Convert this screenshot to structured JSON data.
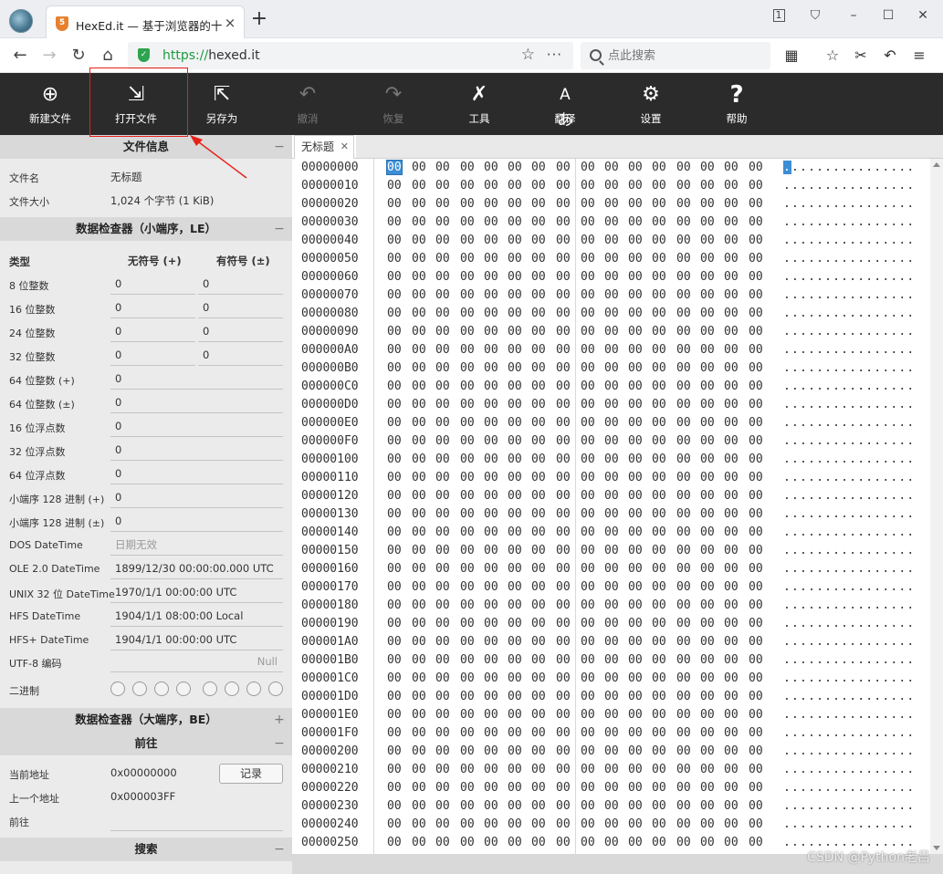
{
  "browser": {
    "tab_title": "HexEd.it — 基于浏览器的十六",
    "url_proto": "https://",
    "url_host": "hexed.it",
    "search_placeholder": "点此搜索",
    "tab_count": "1"
  },
  "toolbar": [
    {
      "label": "新建文件",
      "icon": "new-file-icon",
      "enabled": true
    },
    {
      "label": "打开文件",
      "icon": "open-file-icon",
      "enabled": true
    },
    {
      "label": "另存为",
      "icon": "save-as-icon",
      "enabled": true
    },
    {
      "label": "撤消",
      "icon": "undo-icon",
      "enabled": false
    },
    {
      "label": "恢复",
      "icon": "redo-icon",
      "enabled": false
    },
    {
      "label": "工具",
      "icon": "tools-icon",
      "enabled": true
    },
    {
      "label": "翻译",
      "icon": "translate-icon",
      "enabled": true
    },
    {
      "label": "设置",
      "icon": "settings-icon",
      "enabled": true
    },
    {
      "label": "帮助",
      "icon": "help-icon",
      "enabled": true
    }
  ],
  "file_info": {
    "title": "文件信息",
    "name_label": "文件名",
    "name_value": "无标题",
    "size_label": "文件大小",
    "size_value": "1,024 个字节 (1 KiB)"
  },
  "inspector": {
    "title": "数据检查器（小端序，LE）",
    "col_type": "类型",
    "col_unsigned": "无符号 (+)",
    "col_signed": "有符号 (±)",
    "rows": [
      {
        "label": "8 位整数",
        "u": "0",
        "s": "0"
      },
      {
        "label": "16 位整数",
        "u": "0",
        "s": "0"
      },
      {
        "label": "24 位整数",
        "u": "0",
        "s": "0"
      },
      {
        "label": "32 位整数",
        "u": "0",
        "s": "0"
      },
      {
        "label": "64 位整数 (+)",
        "u": "0"
      },
      {
        "label": "64 位整数 (±)",
        "u": "0"
      },
      {
        "label": "16 位浮点数",
        "u": "0"
      },
      {
        "label": "32 位浮点数",
        "u": "0"
      },
      {
        "label": "64 位浮点数",
        "u": "0"
      },
      {
        "label": "小端序 128 进制 (+)",
        "u": "0"
      },
      {
        "label": "小端序 128 进制 (±)",
        "u": "0"
      },
      {
        "label": "DOS DateTime",
        "u": "日期无效",
        "gray": true
      },
      {
        "label": "OLE 2.0 DateTime",
        "u": "1899/12/30 00:00:00.000 UTC"
      },
      {
        "label": "UNIX 32 位 DateTime",
        "u": "1970/1/1 00:00:00 UTC"
      },
      {
        "label": "HFS DateTime",
        "u": "1904/1/1 08:00:00 Local"
      },
      {
        "label": "HFS+ DateTime",
        "u": "1904/1/1 00:00:00 UTC"
      }
    ],
    "utf8_label": "UTF-8 编码",
    "utf8_value": "Null",
    "binary_label": "二进制"
  },
  "inspector_be": {
    "title": "数据检查器（大端序，BE）"
  },
  "goto": {
    "title": "前往",
    "current_label": "当前地址",
    "current_value": "0x00000000",
    "record_button": "记录",
    "prev_label": "上一个地址",
    "prev_value": "0x000003FF",
    "goto_label": "前往"
  },
  "search_section": {
    "title": "搜索"
  },
  "hex_tab": {
    "name": "无标题"
  },
  "hex": {
    "offsets": [
      "00000000",
      "00000010",
      "00000020",
      "00000030",
      "00000040",
      "00000050",
      "00000060",
      "00000070",
      "00000080",
      "00000090",
      "000000A0",
      "000000B0",
      "000000C0",
      "000000D0",
      "000000E0",
      "000000F0",
      "00000100",
      "00000110",
      "00000120",
      "00000130",
      "00000140",
      "00000150",
      "00000160",
      "00000170",
      "00000180",
      "00000190",
      "000001A0",
      "000001B0",
      "000001C0",
      "000001D0",
      "000001E0",
      "000001F0",
      "00000200",
      "00000210",
      "00000220",
      "00000230",
      "00000240",
      "00000250"
    ],
    "byte": "00",
    "ascii": "................"
  },
  "watermark": "CSDN @Python老吕"
}
